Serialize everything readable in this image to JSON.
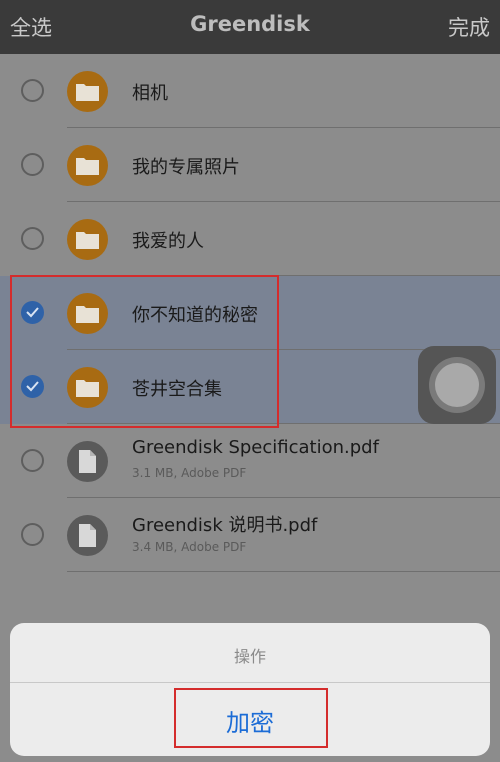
{
  "navbar": {
    "select_all": "全选",
    "title": "Greendisk",
    "done": "完成"
  },
  "items": [
    {
      "name": "相机",
      "type": "folder",
      "selected": false
    },
    {
      "name": "我的专属照片",
      "type": "folder",
      "selected": false
    },
    {
      "name": "我爱的人",
      "type": "folder",
      "selected": false
    },
    {
      "name": "你不知道的秘密",
      "type": "folder",
      "selected": true
    },
    {
      "name": "苍井空合集",
      "type": "folder",
      "selected": true
    },
    {
      "name": "Greendisk Specification.pdf",
      "type": "file",
      "meta": "3.1 MB, Adobe PDF",
      "selected": false
    },
    {
      "name": "Greendisk 说明书.pdf",
      "type": "file",
      "meta": "3.4 MB, Adobe PDF",
      "selected": false
    }
  ],
  "action_sheet": {
    "title": "操作",
    "action": "加密"
  },
  "colors": {
    "accent": "#1c6cd6",
    "folder": "#a86b12",
    "highlight": "#d42c2c"
  }
}
